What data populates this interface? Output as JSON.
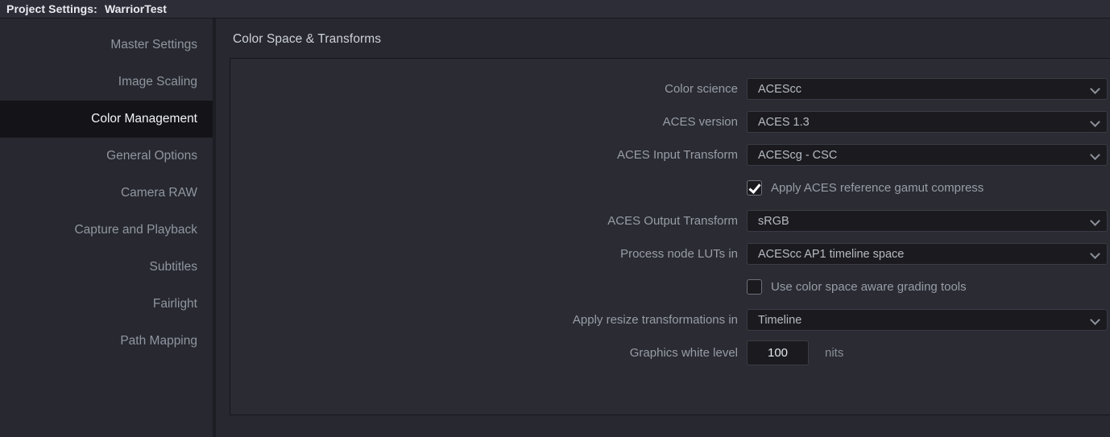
{
  "titlebar": {
    "label": "Project Settings:",
    "project_name": "WarriorTest"
  },
  "sidebar": {
    "items": [
      {
        "label": "Master Settings",
        "selected": false
      },
      {
        "label": "Image Scaling",
        "selected": false
      },
      {
        "label": "Color Management",
        "selected": true
      },
      {
        "label": "General Options",
        "selected": false
      },
      {
        "label": "Camera RAW",
        "selected": false
      },
      {
        "label": "Capture and Playback",
        "selected": false
      },
      {
        "label": "Subtitles",
        "selected": false
      },
      {
        "label": "Fairlight",
        "selected": false
      },
      {
        "label": "Path Mapping",
        "selected": false
      }
    ]
  },
  "content": {
    "section_title": "Color Space & Transforms",
    "fields": {
      "color_science": {
        "label": "Color science",
        "value": "ACEScc",
        "icon": "chevron-down-icon"
      },
      "aces_version": {
        "label": "ACES version",
        "value": "ACES 1.3",
        "icon": "chevron-down-icon"
      },
      "aces_input_transform": {
        "label": "ACES Input Transform",
        "value": "ACEScg - CSC",
        "icon": "chevron-down-icon"
      },
      "gamut_compress": {
        "label": "Apply ACES reference gamut compress",
        "checked": true
      },
      "aces_output_transform": {
        "label": "ACES Output Transform",
        "value": "sRGB",
        "icon": "chevron-down-icon"
      },
      "process_node_luts": {
        "label": "Process node LUTs in",
        "value": "ACEScc AP1 timeline space",
        "icon": "chevron-down-icon"
      },
      "color_space_aware": {
        "label": "Use color space aware grading tools",
        "checked": false
      },
      "resize_transformations": {
        "label": "Apply resize transformations in",
        "value": "Timeline",
        "icon": "chevron-down-icon"
      },
      "graphics_white_level": {
        "label": "Graphics white level",
        "value": "100",
        "unit": "nits"
      }
    }
  },
  "colors": {
    "window_bg": "#272830",
    "titlebar_bg": "#2c2d36",
    "panel_bg": "#2a2b33",
    "field_bg": "#1b1b1f",
    "selected_item_bg": "#141418",
    "text_primary": "#e9ecf1",
    "text_muted": "#989da7"
  }
}
